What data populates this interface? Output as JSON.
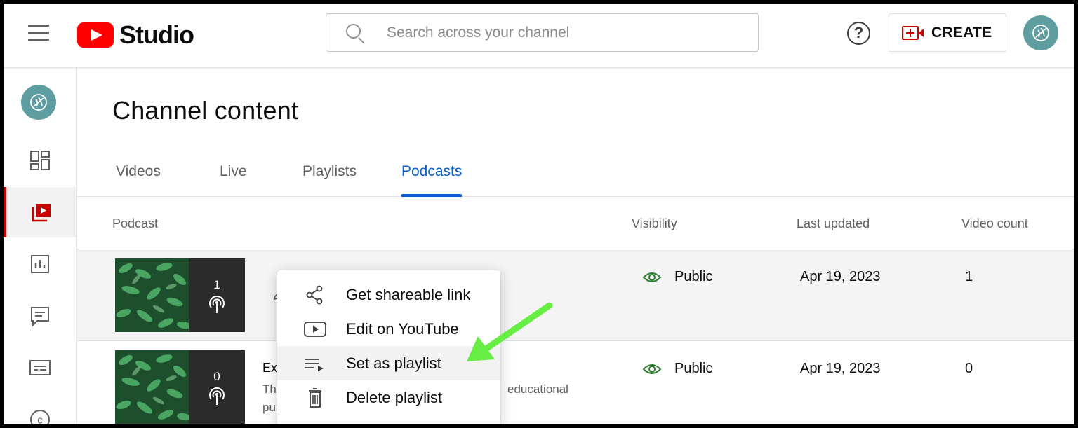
{
  "app": {
    "brand": "Studio",
    "search_placeholder": "Search across your channel",
    "create_label": "CREATE",
    "help_glyph": "?"
  },
  "sidebar": {
    "items": [
      {
        "icon": "dashboard-icon"
      },
      {
        "icon": "content-icon",
        "active": true
      },
      {
        "icon": "analytics-icon"
      },
      {
        "icon": "comments-icon"
      },
      {
        "icon": "subtitles-icon"
      },
      {
        "icon": "copyright-icon"
      }
    ]
  },
  "main": {
    "title": "Channel content",
    "tabs": [
      {
        "label": "Videos"
      },
      {
        "label": "Live"
      },
      {
        "label": "Playlists"
      },
      {
        "label": "Podcasts",
        "active": true
      }
    ],
    "columns": {
      "podcast": "Podcast",
      "visibility": "Visibility",
      "last_updated": "Last updated",
      "video_count": "Video count"
    },
    "rows": [
      {
        "thumb_count": "1",
        "title": "",
        "description_1": "",
        "description_2": "",
        "visibility": "Public",
        "last_updated": "Apr 19, 2023",
        "video_count": "1"
      },
      {
        "thumb_count": "0",
        "title": "Exa",
        "description_1": "Thi",
        "description_2": "pur",
        "description_tail": "educational",
        "visibility": "Public",
        "last_updated": "Apr 19, 2023",
        "video_count": "0"
      }
    ]
  },
  "menu": {
    "items": [
      {
        "label": "Get shareable link",
        "icon": "share-icon"
      },
      {
        "label": "Edit on YouTube",
        "icon": "youtube-icon"
      },
      {
        "label": "Set as playlist",
        "icon": "playlist-add-icon",
        "highlighted": true
      },
      {
        "label": "Delete playlist",
        "icon": "trash-icon"
      }
    ]
  },
  "colors": {
    "accent_blue": "#065fd4",
    "brand_red": "#ff0000",
    "annotation_arrow": "#66ee44",
    "public_icon": "#2e7d32"
  }
}
